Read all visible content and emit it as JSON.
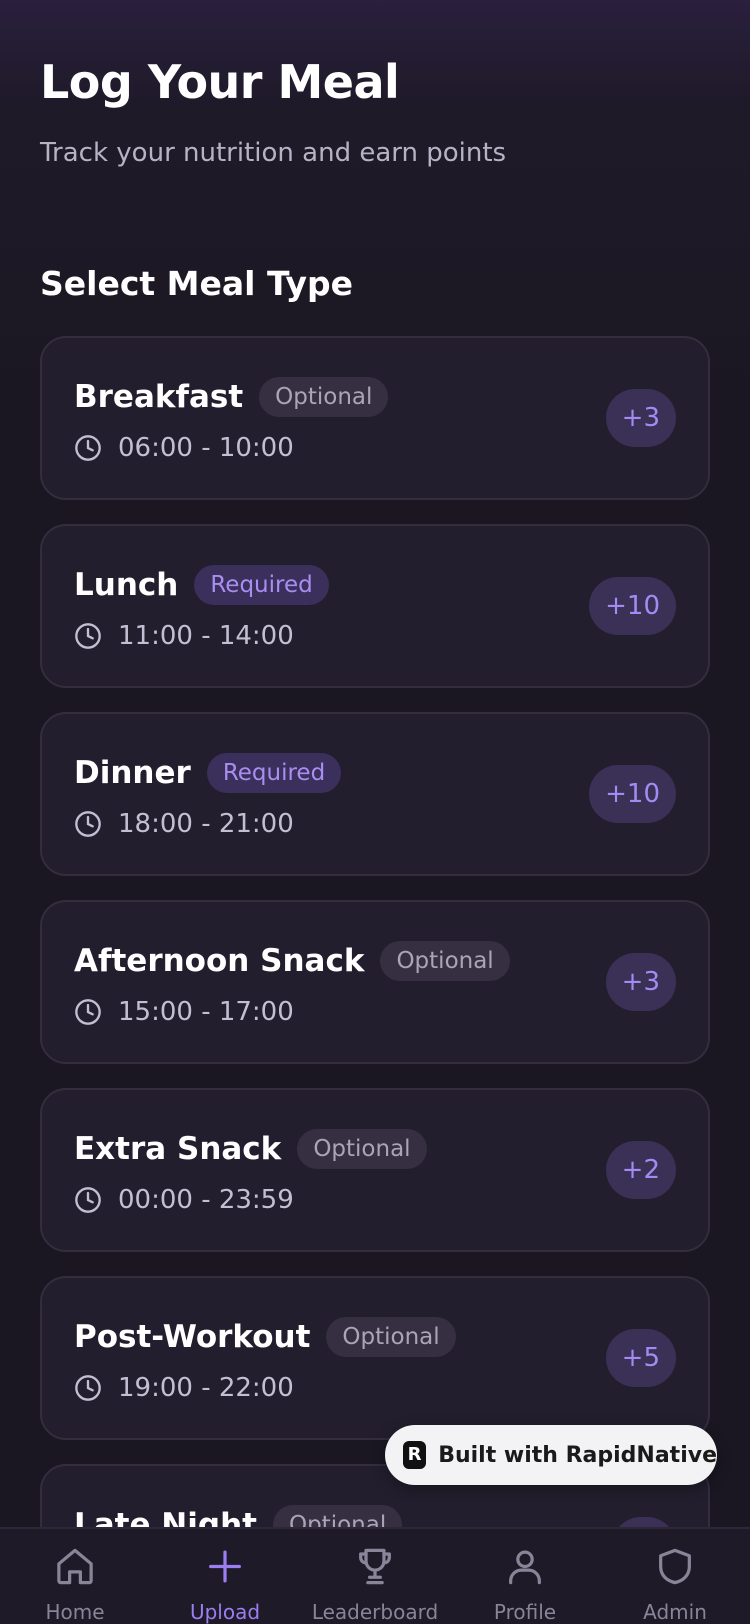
{
  "header": {
    "title": "Log Your Meal",
    "subtitle": "Track your nutrition and earn points"
  },
  "section": {
    "title": "Select Meal Type"
  },
  "meals": [
    {
      "name": "Breakfast",
      "badge": "Optional",
      "badge_type": "optional",
      "time": "06:00 - 10:00",
      "points": "+3"
    },
    {
      "name": "Lunch",
      "badge": "Required",
      "badge_type": "required",
      "time": "11:00 - 14:00",
      "points": "+10"
    },
    {
      "name": "Dinner",
      "badge": "Required",
      "badge_type": "required",
      "time": "18:00 - 21:00",
      "points": "+10"
    },
    {
      "name": "Afternoon Snack",
      "badge": "Optional",
      "badge_type": "optional",
      "time": "15:00 - 17:00",
      "points": "+3"
    },
    {
      "name": "Extra Snack",
      "badge": "Optional",
      "badge_type": "optional",
      "time": "00:00 - 23:59",
      "points": "+2"
    },
    {
      "name": "Post-Workout",
      "badge": "Optional",
      "badge_type": "optional",
      "time": "19:00 - 22:00",
      "points": "+5"
    },
    {
      "name": "Late Night",
      "badge": "Optional",
      "badge_type": "optional",
      "time": "",
      "points": ""
    }
  ],
  "tabs": [
    {
      "label": "Home",
      "icon": "home-icon",
      "active": false
    },
    {
      "label": "Upload",
      "icon": "plus-icon",
      "active": true
    },
    {
      "label": "Leaderboard",
      "icon": "trophy-icon",
      "active": false
    },
    {
      "label": "Profile",
      "icon": "user-icon",
      "active": false
    },
    {
      "label": "Admin",
      "icon": "shield-icon",
      "active": false
    }
  ],
  "built_with": {
    "label": "Built with RapidNative",
    "logo_letter": "R"
  },
  "colors": {
    "background": "#1b1722",
    "card": "#231e2d",
    "accent": "#9a7ef2",
    "required_badge": "#3b2f5c",
    "optional_badge": "#352f41"
  }
}
